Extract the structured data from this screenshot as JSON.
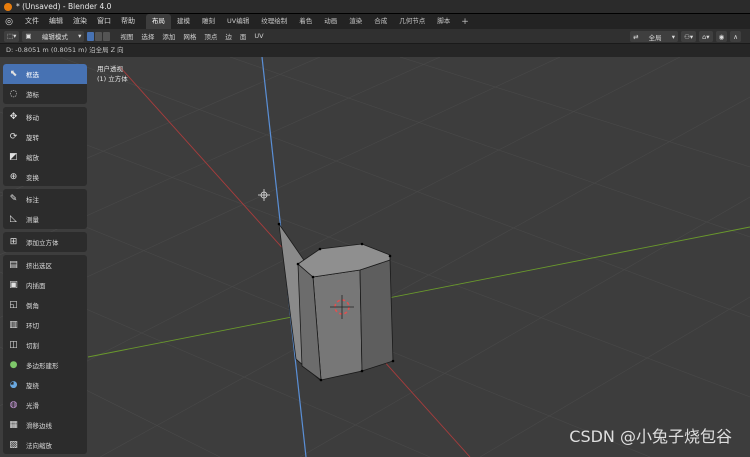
{
  "window": {
    "title": "* (Unsaved) - Blender 4.0"
  },
  "menubar": {
    "menus": [
      "文件",
      "编辑",
      "渲染",
      "窗口",
      "帮助"
    ],
    "workspaces": [
      "布局",
      "建模",
      "雕刻",
      "UV编辑",
      "纹理绘制",
      "着色",
      "动画",
      "渲染",
      "合成",
      "几何节点",
      "脚本"
    ],
    "active_workspace": "布局",
    "add_workspace": "+"
  },
  "header3d": {
    "mode": "编辑模式",
    "menus": [
      "视图",
      "选择",
      "添加",
      "网格",
      "顶点",
      "边",
      "面",
      "UV"
    ],
    "orientation": "全局"
  },
  "status": {
    "text": "D: -0.8051 m (0.8051 m) 沿全局 Z 向"
  },
  "viewport": {
    "view_name": "用户透视",
    "object_name": "(1) 立方体"
  },
  "tools": {
    "groups": [
      [
        {
          "label": "框选",
          "icon": "select-box-icon",
          "active": true
        },
        {
          "label": "游标",
          "icon": "cursor-icon"
        }
      ],
      [
        {
          "label": "移动",
          "icon": "move-icon"
        },
        {
          "label": "旋转",
          "icon": "rotate-icon"
        },
        {
          "label": "缩放",
          "icon": "scale-icon"
        },
        {
          "label": "变换",
          "icon": "transform-icon"
        }
      ],
      [
        {
          "label": "标注",
          "icon": "annotate-icon"
        },
        {
          "label": "测量",
          "icon": "measure-icon"
        }
      ],
      [
        {
          "label": "添加立方体",
          "icon": "add-cube-icon"
        }
      ],
      [
        {
          "label": "挤出选区",
          "icon": "extrude-icon"
        },
        {
          "label": "内插面",
          "icon": "inset-icon"
        },
        {
          "label": "倒角",
          "icon": "bevel-icon"
        },
        {
          "label": "环切",
          "icon": "loop-cut-icon"
        },
        {
          "label": "切割",
          "icon": "knife-icon"
        },
        {
          "label": "多边形建形",
          "icon": "poly-build-icon"
        },
        {
          "label": "旋绕",
          "icon": "spin-icon"
        },
        {
          "label": "光滑",
          "icon": "smooth-icon"
        },
        {
          "label": "滑移边线",
          "icon": "edge-slide-icon"
        },
        {
          "label": "法向缩放",
          "icon": "shrink-fatten-icon"
        }
      ]
    ]
  },
  "watermark": "CSDN @小兔子烧包谷"
}
